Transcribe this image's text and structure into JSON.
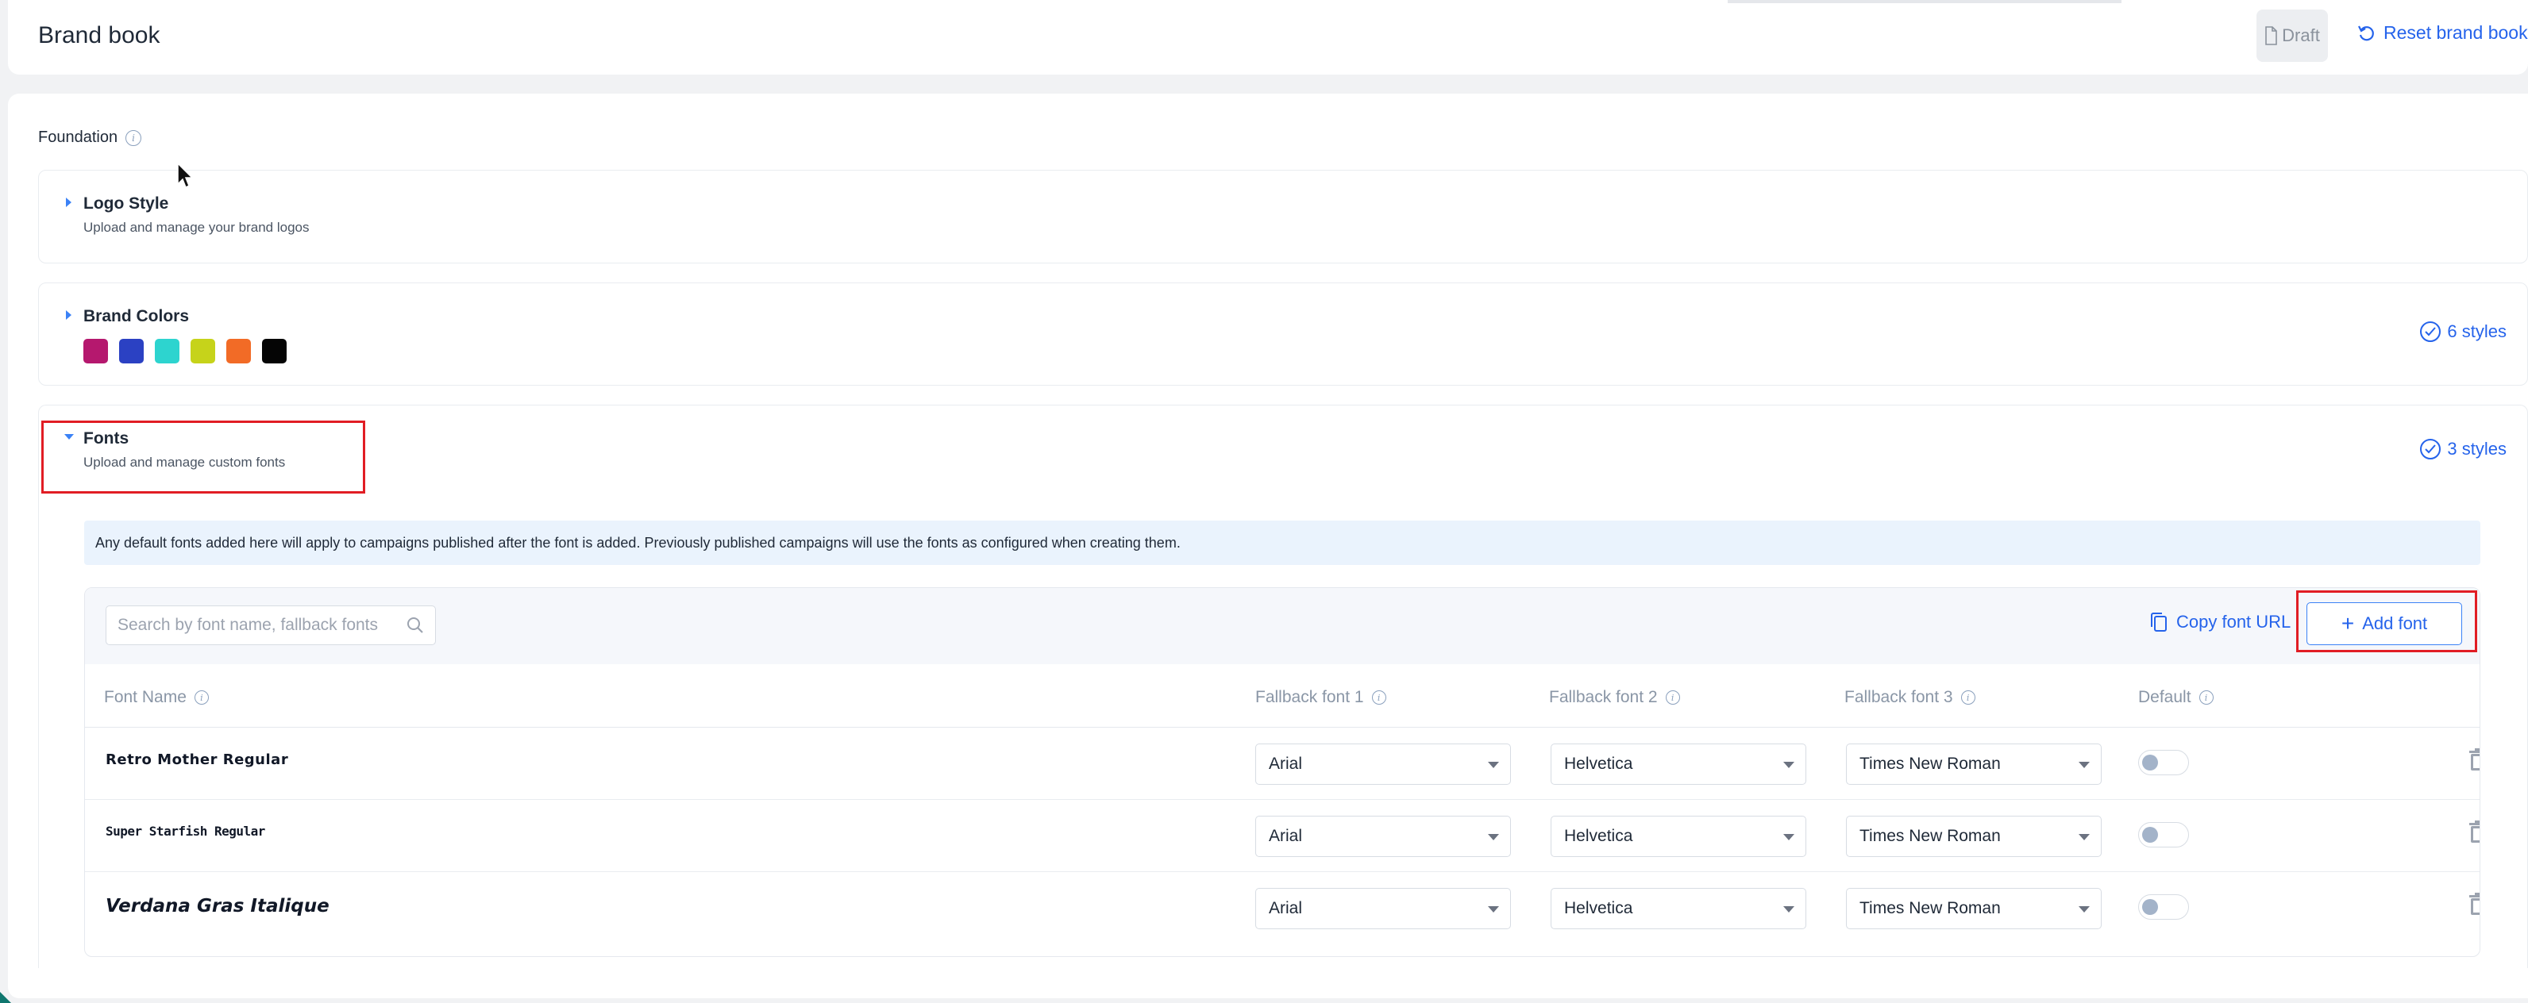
{
  "header": {
    "title": "Brand book",
    "draft_label": "Draft",
    "reset_label": "Reset brand book"
  },
  "foundation": {
    "label": "Foundation"
  },
  "sections": {
    "logo": {
      "title": "Logo Style",
      "subtitle": "Upload and manage your brand logos"
    },
    "colors": {
      "title": "Brand Colors",
      "swatches": [
        "#b5186e",
        "#2b41c3",
        "#2dd4cf",
        "#c6d31a",
        "#f26b26",
        "#050505"
      ],
      "styles_count": "6 styles"
    },
    "fonts": {
      "title": "Fonts",
      "subtitle": "Upload and manage custom fonts",
      "styles_count": "3 styles",
      "notice": "Any default fonts added here will apply to campaigns published after the font is added. Previously published campaigns will use the fonts as configured when creating them.",
      "search_placeholder": "Search by font name, fallback fonts",
      "copy_url_label": "Copy font URL",
      "add_font_label": "Add font",
      "columns": {
        "font_name": "Font Name",
        "fallback1": "Fallback font 1",
        "fallback2": "Fallback font 2",
        "fallback3": "Fallback font 3",
        "default": "Default"
      },
      "rows": [
        {
          "name": "Retro Mother Regular",
          "fallback1": "Arial",
          "fallback2": "Helvetica",
          "fallback3": "Times New Roman",
          "default": false
        },
        {
          "name": "Super Starfish Regular",
          "fallback1": "Arial",
          "fallback2": "Helvetica",
          "fallback3": "Times New Roman",
          "default": false
        },
        {
          "name": "Verdana Gras Italique",
          "fallback1": "Arial",
          "fallback2": "Helvetica",
          "fallback3": "Times New Roman",
          "default": false
        }
      ]
    }
  },
  "colors": {
    "accent": "#2563eb",
    "highlight": "#e11d24"
  }
}
